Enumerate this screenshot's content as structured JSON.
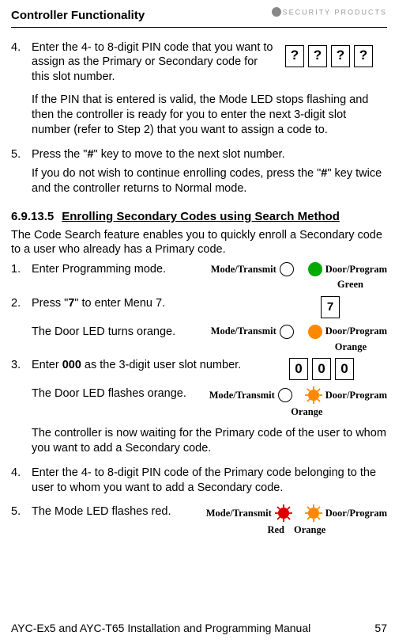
{
  "header": {
    "title": "Controller Functionality",
    "brand": "SECURITY PRODUCTS"
  },
  "step4": {
    "num": "4.",
    "text": "Enter the 4- to 8-digit PIN code that you want to assign as the Primary or Secondary code for this slot number.",
    "pin_chars": [
      "?",
      "?",
      "?",
      "?"
    ],
    "after": "If the PIN that is entered is valid, the Mode LED stops flashing and then the controller is ready for you to enter the next 3-digit slot number (refer to Step 2) that you want to assign a code to."
  },
  "step5a": {
    "num": "5.",
    "line1a": "Press the \"",
    "hash1": "#",
    "line1b": "\" key to move to the next slot number.",
    "line2a": "If you do not wish to continue enrolling codes, press the \"",
    "hash2": "#",
    "line2b": "\" key twice and the controller returns to Normal mode."
  },
  "section": {
    "num": "6.9.13.5",
    "title": "Enrolling Secondary Codes using Search Method",
    "intro": "The Code Search feature enables you to quickly enroll a Secondary code to a user who already has a Primary code."
  },
  "s2step1": {
    "num": "1.",
    "text": "Enter Programming mode.",
    "led_left": "Mode/Transmit",
    "led_right": "Door/Program",
    "color_label": "Green"
  },
  "s2step2": {
    "num": "2.",
    "line1a": "Press \"",
    "seven": "7",
    "line1b": "\" to enter Menu 7.",
    "key": "7",
    "line2": "The Door LED turns orange.",
    "led_left": "Mode/Transmit",
    "led_right": "Door/Program",
    "color_label": "Orange"
  },
  "s2step3": {
    "num": "3.",
    "text_a": "Enter ",
    "zeros": "000",
    "text_b": " as the 3-digit user slot number.",
    "digits": [
      "0",
      "0",
      "0"
    ],
    "line2": "The Door LED flashes orange.",
    "led_left": "Mode/Transmit",
    "led_right": "Door/Program",
    "color_label": "Orange",
    "after": "The controller is now waiting for the Primary code of the user to whom you want to add a Secondary code."
  },
  "s2step4": {
    "num": "4.",
    "text": "Enter the 4- to 8-digit PIN code of the Primary code belonging to the user to whom you want to add a Secondary code."
  },
  "s2step5": {
    "num": "5.",
    "text": "The Mode LED flashes red.",
    "led_left": "Mode/Transmit",
    "led_right": "Door/Program",
    "color_left": "Red",
    "color_right": "Orange"
  },
  "footer": {
    "left": "AYC-Ex5 and AYC-T65 Installation and Programming Manual",
    "right": "57"
  }
}
